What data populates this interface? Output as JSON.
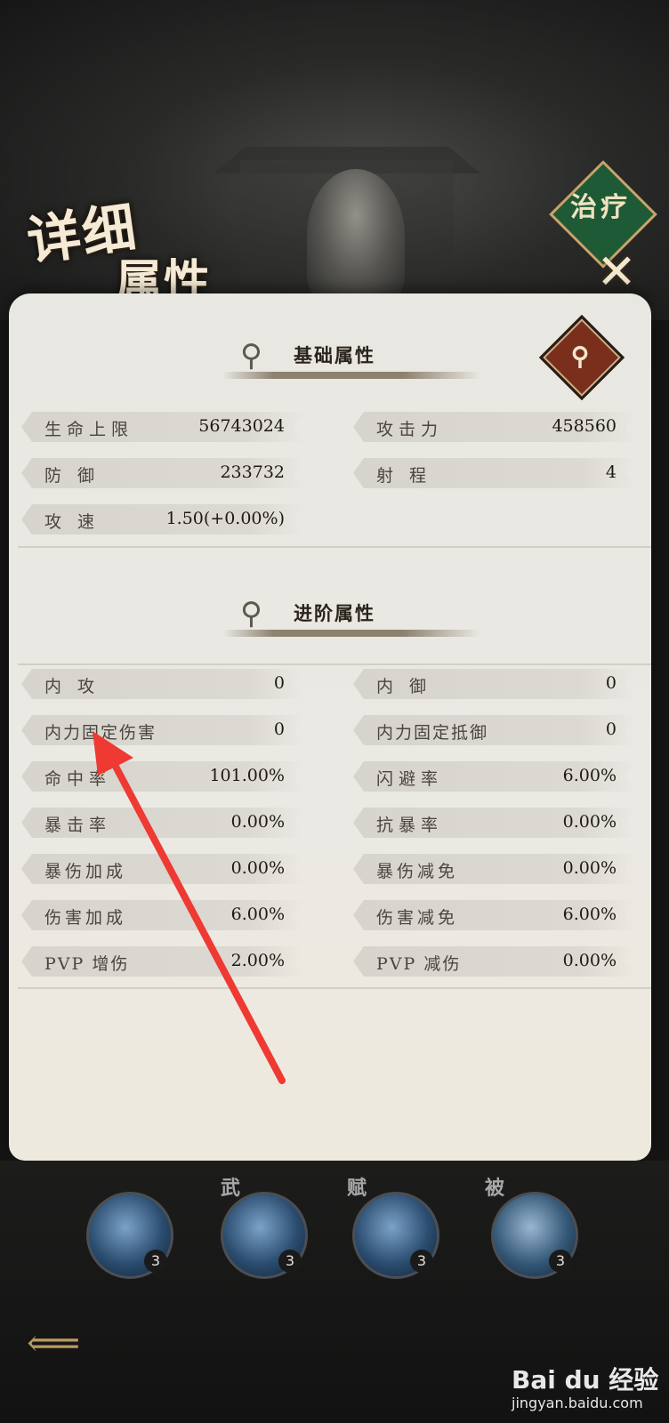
{
  "header": {
    "title_line1": "详细",
    "title_line2": "属性",
    "badge_text": "治疗",
    "close_symbol": "✕"
  },
  "basic": {
    "heading": "基础属性",
    "search_icon": "magnifier-icon",
    "stats": [
      {
        "label": "生命上限",
        "value": "56743024"
      },
      {
        "label": "攻击力",
        "value": "458560"
      },
      {
        "label": "防 御",
        "value": "233732"
      },
      {
        "label": "射 程",
        "value": "4"
      },
      {
        "label": "攻 速",
        "value": "1.50(+0.00%)"
      }
    ]
  },
  "advanced": {
    "heading": "进阶属性",
    "stats": [
      {
        "label": "内 攻",
        "value": "0"
      },
      {
        "label": "内 御",
        "value": "0"
      },
      {
        "label": "内力固定伤害",
        "value": "0"
      },
      {
        "label": "内力固定抵御",
        "value": "0"
      },
      {
        "label": "命中率",
        "value": "101.00%"
      },
      {
        "label": "闪避率",
        "value": "6.00%"
      },
      {
        "label": "暴击率",
        "value": "0.00%"
      },
      {
        "label": "抗暴率",
        "value": "0.00%"
      },
      {
        "label": "暴伤加成",
        "value": "0.00%"
      },
      {
        "label": "暴伤减免",
        "value": "0.00%"
      },
      {
        "label": "伤害加成",
        "value": "6.00%"
      },
      {
        "label": "伤害减免",
        "value": "6.00%"
      },
      {
        "label": "PVP 增伤",
        "value": "2.00%"
      },
      {
        "label": "PVP 减伤",
        "value": "0.00%"
      }
    ]
  },
  "skills": [
    {
      "tag": "",
      "level": "3"
    },
    {
      "tag": "武",
      "level": "3"
    },
    {
      "tag": "赋",
      "level": "3"
    },
    {
      "tag": "被",
      "level": "3"
    }
  ],
  "watermark": {
    "logo": "Bai du 经验",
    "url": "jingyan.baidu.com"
  },
  "colors": {
    "panel": "#e9e7e1",
    "stat_bar": "#d7d4cd",
    "arrow": "#ee3a33",
    "badge": "#1f5a36"
  }
}
